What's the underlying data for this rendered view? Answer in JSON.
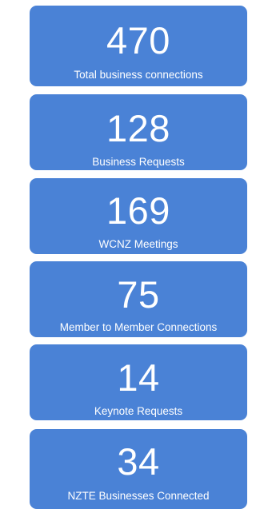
{
  "colors": {
    "card_background": "#4a82d6",
    "text": "#ffffff"
  },
  "stats": [
    {
      "value": "470",
      "label": "Total business connections"
    },
    {
      "value": "128",
      "label": "Business Requests"
    },
    {
      "value": "169",
      "label": "WCNZ Meetings"
    },
    {
      "value": "75",
      "label": "Member to Member Connections"
    },
    {
      "value": "14",
      "label": "Keynote Requests"
    },
    {
      "value": "34",
      "label": "NZTE Businesses Connected"
    }
  ]
}
